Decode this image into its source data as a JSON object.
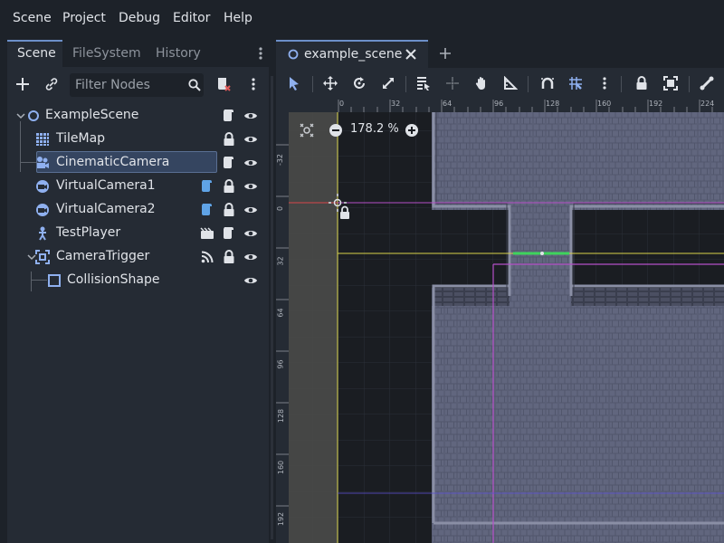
{
  "menu": {
    "items": [
      "Scene",
      "Project",
      "Debug",
      "Editor",
      "Help"
    ]
  },
  "left_dock": {
    "tabs": [
      "Scene",
      "FileSystem",
      "History"
    ],
    "active_tab": "Scene",
    "filter_placeholder": "Filter Nodes",
    "tree": [
      {
        "label": "ExampleScene",
        "icon": "node2d-icon",
        "selected": false
      },
      {
        "label": "TileMap",
        "icon": "tilemap-icon",
        "selected": false
      },
      {
        "label": "CinematicCamera",
        "icon": "camera-icon",
        "selected": true
      },
      {
        "label": "VirtualCamera1",
        "icon": "virtual-camera-icon",
        "selected": false
      },
      {
        "label": "VirtualCamera2",
        "icon": "virtual-camera-icon",
        "selected": false
      },
      {
        "label": "TestPlayer",
        "icon": "player-icon",
        "selected": false
      },
      {
        "label": "CameraTrigger",
        "icon": "area-icon",
        "selected": false,
        "expanded": true
      },
      {
        "label": "CollisionShape",
        "icon": "collision-shape-icon",
        "selected": false
      }
    ]
  },
  "editor": {
    "scene_tab_label": "example_scene",
    "zoom_label": "178.2 %",
    "ruler_h": [
      "0",
      "32",
      "64",
      "96",
      "128",
      "160",
      "192",
      "224"
    ],
    "ruler_v": [
      "-32",
      "0",
      "32",
      "64",
      "96",
      "128",
      "160",
      "192"
    ]
  },
  "colors": {
    "accent": "#6c8fc9",
    "selection": "#354560",
    "script_blue": "#5fa3e6",
    "axis_yellow": "#d8d24a",
    "axis_red": "#d6474a",
    "camera_magenta": "#b54fc7",
    "trigger_green": "#3ed35c"
  }
}
